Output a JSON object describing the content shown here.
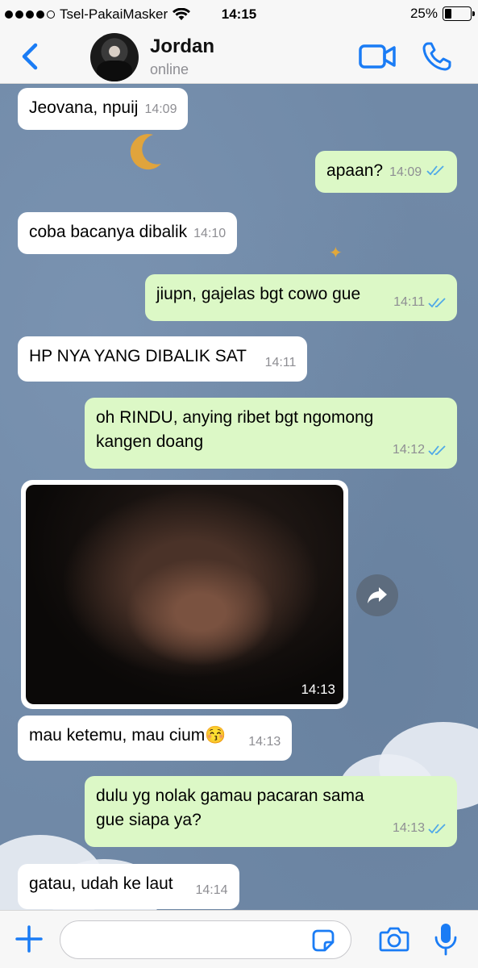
{
  "status_bar": {
    "carrier": "Tsel-PakaiMasker",
    "time": "14:15",
    "battery_percent": "25%",
    "battery_level": 0.25,
    "signal_bars": 4
  },
  "header": {
    "contact_name": "Jordan",
    "contact_status": "online"
  },
  "messages": [
    {
      "direction": "in",
      "text": "Jeovana, npuij",
      "time": "14:09"
    },
    {
      "direction": "out",
      "text": "apaan?",
      "time": "14:09",
      "read": true
    },
    {
      "direction": "in",
      "text": "coba bacanya dibalik",
      "time": "14:10"
    },
    {
      "direction": "out",
      "text": "jiupn, gajelas bgt cowo gue",
      "time": "14:11",
      "read": true
    },
    {
      "direction": "in",
      "text": "HP NYA YANG DIBALIK SAT",
      "time": "14:11"
    },
    {
      "direction": "out",
      "text_line1": "oh RINDU, anying ribet bgt ngomong",
      "text_line2": "kangen doang",
      "time": "14:12",
      "read": true
    },
    {
      "direction": "in",
      "type": "photo",
      "time": "14:13"
    },
    {
      "direction": "in",
      "text": "mau ketemu, mau cium😚",
      "time": "14:13"
    },
    {
      "direction": "out",
      "text_line1": "dulu yg nolak gamau pacaran sama",
      "text_line2": "gue siapa ya?",
      "time": "14:13",
      "read": true
    },
    {
      "direction": "in",
      "text": "gatau, udah ke laut",
      "time": "14:14"
    }
  ],
  "input": {
    "placeholder": "",
    "value": ""
  },
  "colors": {
    "accent": "#1a7cf5",
    "outgoing_bubble": "#dcf8c6",
    "incoming_bubble": "#ffffff",
    "read_ticks": "#4fa8e8"
  },
  "icons": {
    "back": "chevron-left-icon",
    "video": "video-camera-icon",
    "call": "phone-icon",
    "forward": "forward-arrow-icon",
    "plus": "plus-icon",
    "sticker": "sticker-icon",
    "camera": "camera-icon",
    "mic": "microphone-icon"
  }
}
